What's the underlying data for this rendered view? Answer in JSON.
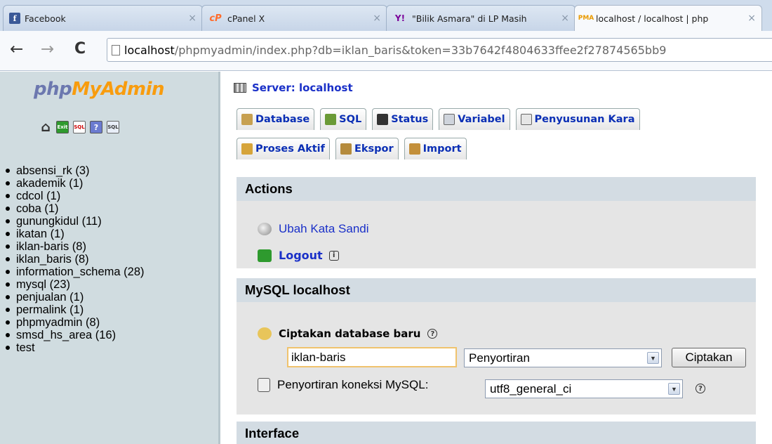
{
  "browser": {
    "tabs": [
      {
        "title": "Facebook",
        "favicon": "facebook-icon",
        "favicon_glyph": "f"
      },
      {
        "title": "cPanel X",
        "favicon": "cpanel-icon",
        "favicon_glyph": "cP"
      },
      {
        "title": "\"Bilik Asmara\" di LP Masih",
        "favicon": "yahoo-icon",
        "favicon_glyph": "Y!"
      },
      {
        "title": "localhost / localhost | php",
        "favicon": "phpmyadmin-icon",
        "favicon_glyph": "PMA"
      }
    ],
    "close_glyph": "×",
    "back_glyph": "←",
    "forward_glyph": "→",
    "reload_glyph": "C",
    "url_host": "localhost",
    "url_rest": "/phpmyadmin/index.php?db=iklan_baris&token=33b7642f4804633ffee2f27874565bb9"
  },
  "sidebar": {
    "logo_php": "php",
    "logo_myadmin": "MyAdmin",
    "icons": [
      "home-icon",
      "exit-icon",
      "sql-icon",
      "help-icon",
      "docs-icon"
    ],
    "databases": [
      "absensi_rk (3)",
      "akademik (1)",
      "cdcol (1)",
      "coba (1)",
      "gunungkidul (11)",
      "ikatan (1)",
      "iklan-baris (8)",
      "iklan_baris (8)",
      "information_schema (28)",
      "mysql (23)",
      "penjualan (1)",
      "permalink (1)",
      "phpmyadmin (8)",
      "smsd_hs_area (16)",
      "test"
    ]
  },
  "main": {
    "server_title": "Server: localhost",
    "tabs_row1": [
      "Database",
      "SQL",
      "Status",
      "Variabel",
      "Penyusunan Kara"
    ],
    "tabs_row2": [
      "Proses Aktif",
      "Ekspor",
      "Import"
    ],
    "actions": {
      "heading": "Actions",
      "change_password": "Ubah Kata Sandi",
      "logout": "Logout"
    },
    "mysql": {
      "heading": "MySQL localhost",
      "create_label": "Ciptakan database baru",
      "db_name_value": "iklan-baris",
      "collation_select": "Penyortiran",
      "create_button": "Ciptakan",
      "connection_label": "Penyortiran koneksi MySQL:",
      "connection_value": "utf8_general_ci"
    },
    "interface": {
      "heading": "Interface"
    }
  },
  "colors": {
    "link": "#1a30c8",
    "section_header": "#d3dce3",
    "section_body": "#e5e5e5",
    "sidebar_bg": "#d0dce0",
    "input_focus": "#f0c36d"
  }
}
